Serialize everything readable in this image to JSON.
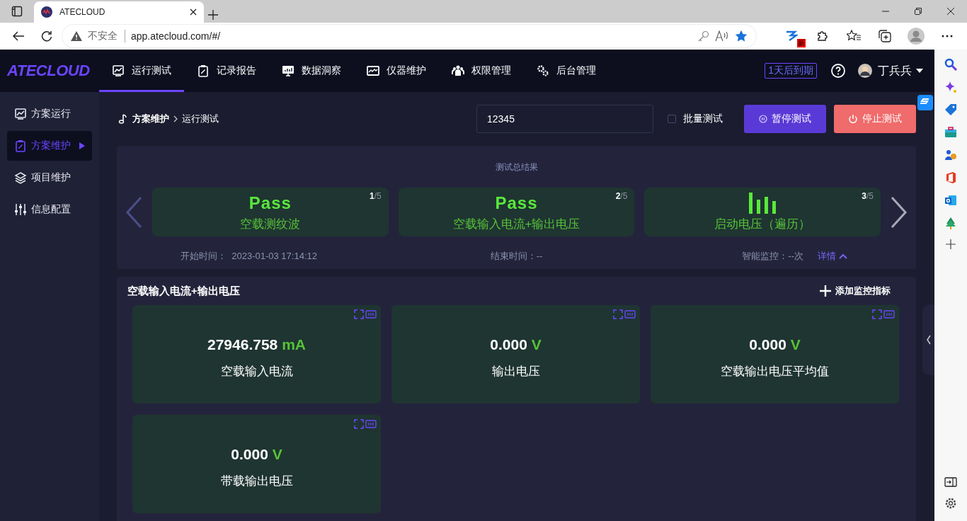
{
  "browser": {
    "tab_title": "ATECLOUD",
    "security": "不安全",
    "url": "app.atecloud.com/#/",
    "extension_badge": "新"
  },
  "header": {
    "logo": "ATECLOUD",
    "nav": [
      {
        "label": "运行测试",
        "selected": true
      },
      {
        "label": "记录报告",
        "selected": false
      },
      {
        "label": "数据洞察",
        "selected": false
      },
      {
        "label": "仪器维护",
        "selected": false
      },
      {
        "label": "权限管理",
        "selected": false
      },
      {
        "label": "后台管理",
        "selected": false
      }
    ],
    "expiry": "1天后到期",
    "user": "丁兵兵"
  },
  "sidebar": {
    "items": [
      {
        "label": "方案运行",
        "selected": false
      },
      {
        "label": "方案维护",
        "selected": true
      },
      {
        "label": "项目维护",
        "selected": false
      },
      {
        "label": "信息配置",
        "selected": false
      }
    ]
  },
  "breadcrumb": [
    "方案维护",
    "运行测试"
  ],
  "search": {
    "value": "12345"
  },
  "batch_test": {
    "label": "批量测试",
    "checked": false
  },
  "buttons": [
    {
      "label": "暂停测试",
      "kind": "pause"
    },
    {
      "label": "停止测试",
      "kind": "stop"
    }
  ],
  "summary": {
    "title": "测试总结果",
    "cards": [
      {
        "kind": "pass",
        "status": "Pass",
        "name": "空载测纹波",
        "index": "1",
        "total": "/5"
      },
      {
        "kind": "pass",
        "status": "Pass",
        "name": "空载输入电流+输出电压",
        "index": "2",
        "total": "/5"
      },
      {
        "kind": "running",
        "name": "启动电压（遍历）",
        "index": "3",
        "total": "/5"
      }
    ],
    "start_label": "开始时间：",
    "start": "2023-01-03 17:14:12",
    "end_label": "结束时间：",
    "end": "--",
    "monitor_label": "智能监控：",
    "monitor": "--次",
    "details": "详情"
  },
  "monitor": {
    "title": "空载输入电流+输出电压",
    "add": "添加监控指标",
    "tiles": [
      {
        "value": "27946.758",
        "unit": "mA",
        "name": "空载输入电流"
      },
      {
        "value": "0.000",
        "unit": "V",
        "name": "输出电压"
      },
      {
        "value": "0.000",
        "unit": "V",
        "name": "空载输出电压平均值"
      },
      {
        "value": "0.000",
        "unit": "V",
        "name": "带载输出电压"
      }
    ]
  }
}
